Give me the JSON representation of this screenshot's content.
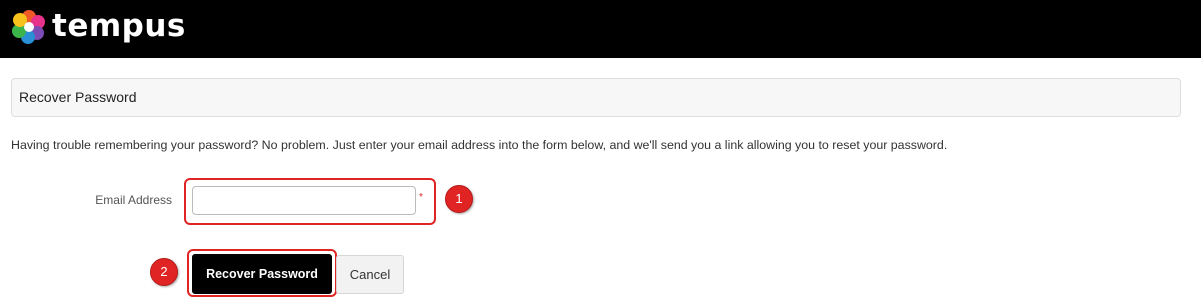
{
  "brand": {
    "name": "tempus",
    "logo_icon": "flower-logo-icon"
  },
  "panel": {
    "title": "Recover Password"
  },
  "intro_text": "Having trouble remembering your password? No problem. Just enter your email address into the form below, and we'll send you a link allowing you to reset your password.",
  "form": {
    "email_label": "Email Address",
    "email_value": "",
    "email_placeholder": "",
    "required_marker": "*"
  },
  "buttons": {
    "submit_label": "Recover Password",
    "cancel_label": "Cancel"
  },
  "annotations": {
    "step1": "1",
    "step2": "2"
  },
  "colors": {
    "topbar": "#000000",
    "highlight": "#e02424",
    "primary_button": "#000000"
  }
}
